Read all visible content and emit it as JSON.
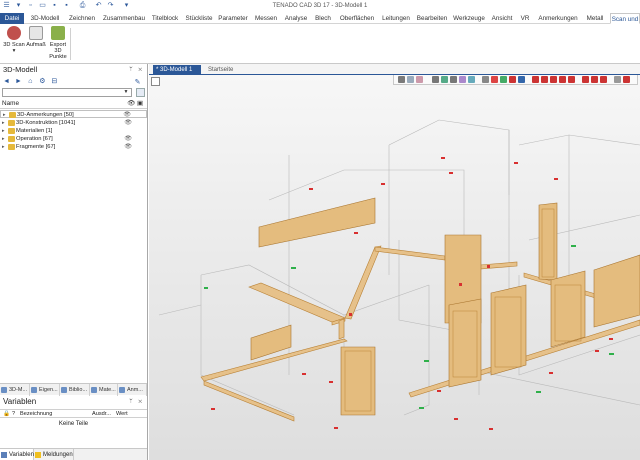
{
  "window": {
    "title": "TENADO CAD 3D 17 - 3D-Modell 1"
  },
  "ribbon_tabs": [
    "Datei",
    "3D-Modell",
    "Zeichnen",
    "Zusammenbau",
    "Titelblock",
    "Stückliste",
    "Parameter",
    "Messen",
    "Analyse",
    "Blech",
    "Oberflächen",
    "Leitungen",
    "Bearbeiten",
    "Werkzeuge",
    "Ansicht",
    "VR",
    "Anmerkungen",
    "Metall",
    "Scan und"
  ],
  "ribbon_buttons": [
    {
      "label": "3D Scan",
      "sub": "▾",
      "icon": "3d-scan-icon",
      "color": "#c0504d"
    },
    {
      "label": "Aufmaß",
      "sub": "",
      "icon": "dice-icon",
      "color": "#d9d9d9"
    },
    {
      "label": "Export 3D",
      "sub": "Punkte",
      "icon": "export-points-icon",
      "color": "#8ab04a"
    }
  ],
  "left_panel": {
    "title": "3D-Modell",
    "column_name": "Name",
    "tree": [
      {
        "label": "3D-Anmerkungen [50]",
        "eye": "👁"
      },
      {
        "label": "3D-Konstruktion [1041]",
        "eye": "👁"
      },
      {
        "label": "Materialien [1]",
        "eye": ""
      },
      {
        "label": "Operation [67]",
        "eye": "👁"
      },
      {
        "label": "Fragmente [67]",
        "eye": "👁"
      }
    ],
    "panel_tabs": [
      "3D-M...",
      "Eigen...",
      "Biblio...",
      "Mate...",
      "Anm..."
    ]
  },
  "variables_panel": {
    "title": "Variablen",
    "columns": [
      "?",
      "Bezeichnung",
      "Ausdr...",
      "Wert"
    ],
    "empty_text": "Keine Teile"
  },
  "bottom_tabs": [
    "Variablen",
    "Meldungen"
  ],
  "document_tabs": [
    "* 3D-Modell 1",
    "Startseite"
  ],
  "colors": {
    "accent": "#2b5797",
    "wood": "#d9a85a",
    "wood_edge": "#b9823a"
  }
}
